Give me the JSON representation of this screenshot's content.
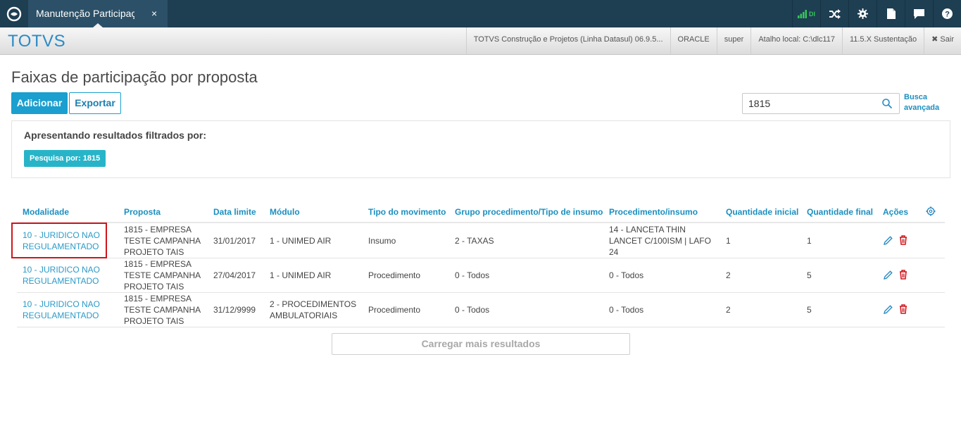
{
  "app": {
    "tab_title": "Manutenção Participaçã",
    "tab_close": "×",
    "signal_label": "DI"
  },
  "header": {
    "brand": "TOTVS",
    "info": [
      "TOTVS Construção e Projetos (Linha Datasul) 06.9.5...",
      "ORACLE",
      "super",
      "Atalho local: C:\\dlc117",
      "11.5.X Sustentação"
    ],
    "logout": "✖ Sair"
  },
  "page": {
    "title": "Faixas de participação por proposta",
    "add_label": "Adicionar",
    "export_label": "Exportar",
    "search_value": "1815",
    "advanced_search_line1": "Busca",
    "advanced_search_line2": "avançada"
  },
  "filter": {
    "title": "Apresentando resultados filtrados por:",
    "tag": "Pesquisa por: 1815"
  },
  "table": {
    "headers": {
      "modalidade": "Modalidade",
      "proposta": "Proposta",
      "data_limite": "Data limite",
      "modulo": "Módulo",
      "tipo_movimento": "Tipo do movimento",
      "grupo": "Grupo procedimento/Tipo de insumo",
      "procedimento": "Procedimento/insumo",
      "qtd_inicial": "Quantidade inicial",
      "qtd_final": "Quantidade final",
      "acoes": "Ações"
    },
    "rows": [
      {
        "modalidade_1": "10 - JURIDICO NAO",
        "modalidade_2": "REGULAMENTADO",
        "proposta_1": "1815 - EMPRESA",
        "proposta_2": "TESTE CAMPANHA",
        "proposta_3": "PROJETO TAIS",
        "data_limite": "31/01/2017",
        "modulo_1": "1 - UNIMED AIR",
        "modulo_2": "",
        "tipo_movimento": "Insumo",
        "grupo": "2 - TAXAS",
        "procedimento_1": "14 - LANCETA THIN",
        "procedimento_2": "LANCET C/100ISM | LAFO",
        "procedimento_3": "24",
        "qtd_inicial": "1",
        "qtd_final": "1"
      },
      {
        "modalidade_1": "10 - JURIDICO NAO",
        "modalidade_2": "REGULAMENTADO",
        "proposta_1": "1815 - EMPRESA",
        "proposta_2": "TESTE CAMPANHA",
        "proposta_3": "PROJETO TAIS",
        "data_limite": "27/04/2017",
        "modulo_1": "1 - UNIMED AIR",
        "modulo_2": "",
        "tipo_movimento": "Procedimento",
        "grupo": "0 - Todos",
        "procedimento_1": "0 - Todos",
        "procedimento_2": "",
        "procedimento_3": "",
        "qtd_inicial": "2",
        "qtd_final": "5"
      },
      {
        "modalidade_1": "10 - JURIDICO NAO",
        "modalidade_2": "REGULAMENTADO",
        "proposta_1": "1815 - EMPRESA",
        "proposta_2": "TESTE CAMPANHA",
        "proposta_3": "PROJETO TAIS",
        "data_limite": "31/12/9999",
        "modulo_1": "2 - PROCEDIMENTOS",
        "modulo_2": "AMBULATORIAIS",
        "tipo_movimento": "Procedimento",
        "grupo": "0 - Todos",
        "procedimento_1": "0 - Todos",
        "procedimento_2": "",
        "procedimento_3": "",
        "qtd_inicial": "2",
        "qtd_final": "5"
      }
    ]
  },
  "load_more": "Carregar mais resultados",
  "colors": {
    "topbar": "#1e3e52",
    "accent": "#1a9fcf",
    "link": "#2b9ac8",
    "tag": "#28b4c8",
    "delete": "#d0141a"
  }
}
